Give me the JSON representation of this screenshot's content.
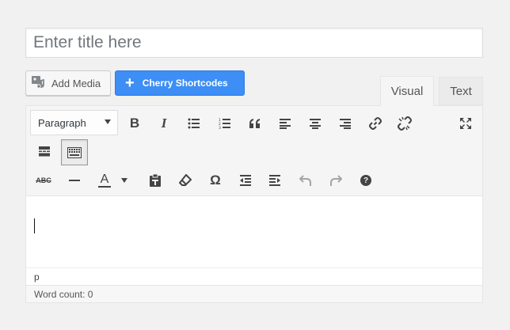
{
  "title_field": {
    "placeholder": "Enter title here",
    "value": ""
  },
  "media_buttons": {
    "add_media_label": "Add Media",
    "cherry_label": "Cherry Shortcodes",
    "cherry_color": "#3d8ef5"
  },
  "tabs": {
    "visual": "Visual",
    "text": "Text",
    "active": "Visual"
  },
  "toolbar": {
    "format_value": "Paragraph",
    "row1": [
      "bold-icon",
      "italic-icon",
      "bulleted-list-icon",
      "numbered-list-icon",
      "blockquote-icon",
      "align-left-icon",
      "align-center-icon",
      "align-right-icon",
      "insert-link-icon",
      "remove-link-icon",
      "fullscreen-icon"
    ],
    "row2": [
      "read-more-icon",
      "toolbar-toggle-icon"
    ],
    "row3": [
      "strikethrough-icon",
      "horizontal-line-icon",
      "text-color-icon",
      "text-color-dropdown-icon",
      "paste-as-text-icon",
      "clear-formatting-icon",
      "special-character-icon",
      "decrease-indent-icon",
      "increase-indent-icon",
      "undo-icon",
      "redo-icon",
      "help-icon"
    ],
    "strikethrough_glyph": "ABC",
    "text_color_glyph": "A",
    "omega_glyph": "Ω",
    "bold_glyph": "B",
    "italic_glyph": "I"
  },
  "path": "p",
  "word_count_label": "Word count: 0"
}
